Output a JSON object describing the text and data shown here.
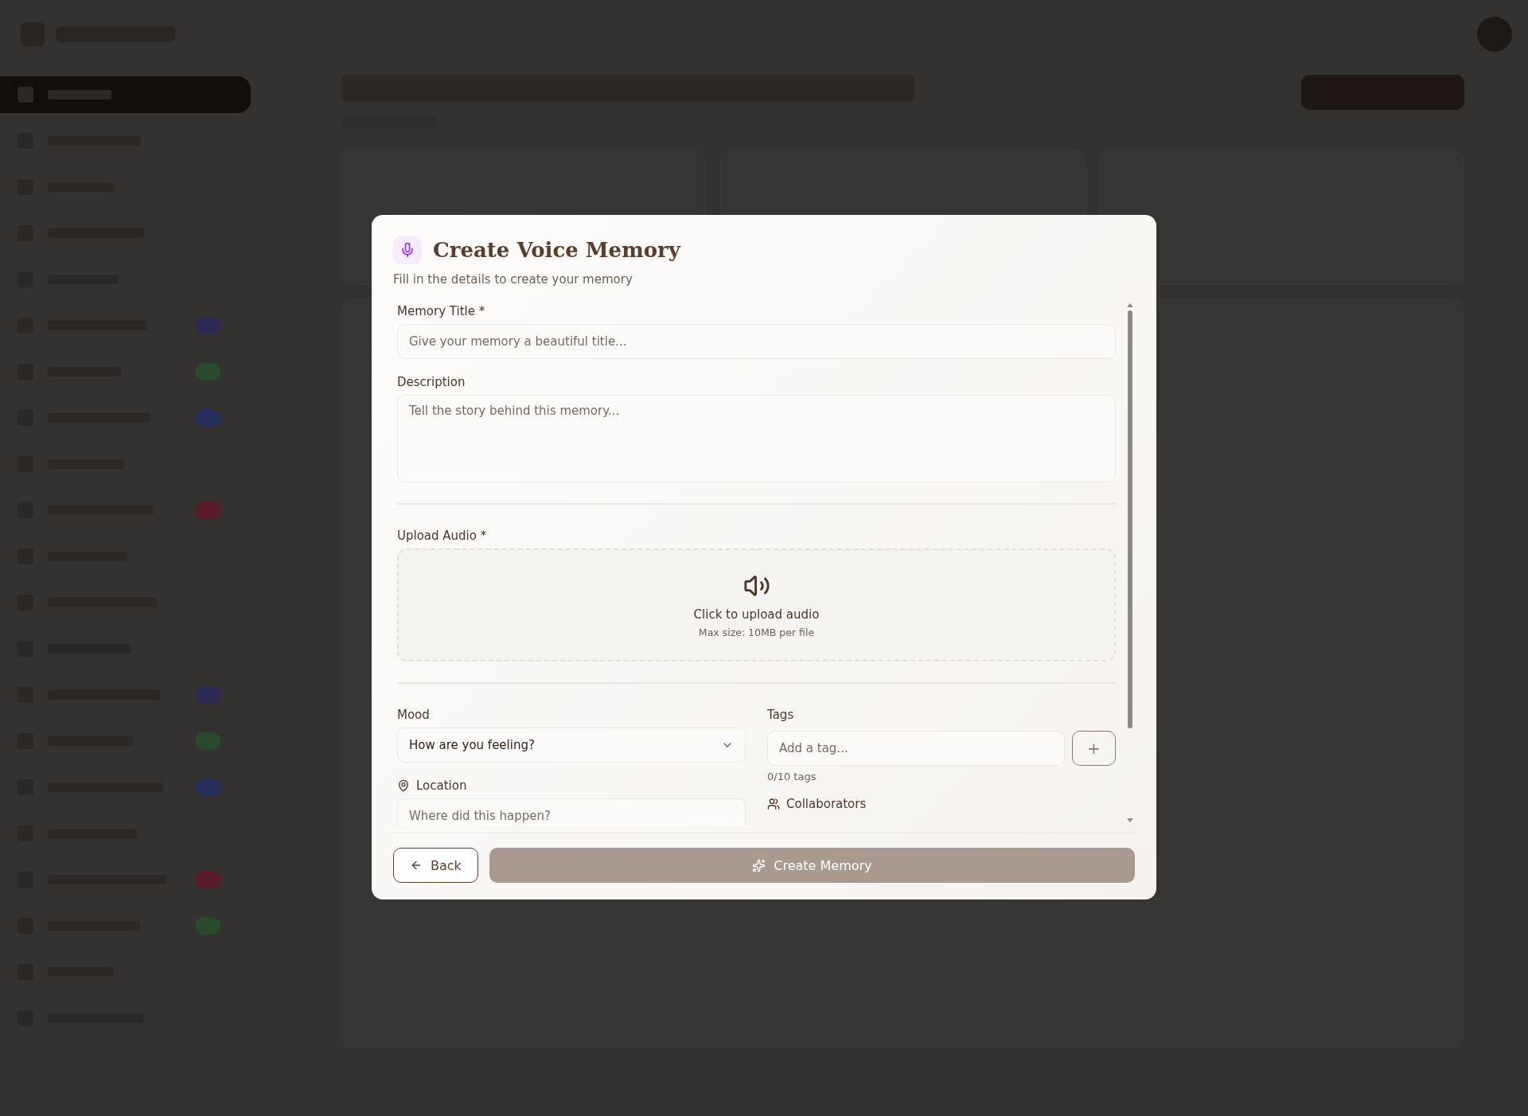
{
  "sidebar": {
    "items": [
      {
        "selected": true
      },
      {
        "selected": false
      },
      {
        "selected": false
      },
      {
        "selected": false
      },
      {
        "selected": false
      },
      {
        "selected": false
      },
      {
        "selected": false
      },
      {
        "selected": false
      },
      {
        "selected": false
      },
      {
        "selected": false
      },
      {
        "selected": false
      },
      {
        "selected": false
      },
      {
        "selected": false
      },
      {
        "selected": false
      },
      {
        "selected": false
      },
      {
        "selected": false
      },
      {
        "selected": false
      },
      {
        "selected": false
      },
      {
        "selected": false
      },
      {
        "selected": false
      },
      {
        "selected": false
      }
    ]
  },
  "dialog": {
    "title": "Create Voice Memory",
    "subtitle": "Fill in the details to create your memory",
    "title_field": {
      "label": "Memory Title *",
      "placeholder": "Give your memory a beautiful title..."
    },
    "description_field": {
      "label": "Description",
      "placeholder": "Tell the story behind this memory..."
    },
    "upload": {
      "label": "Upload Audio *",
      "prompt": "Click to upload audio",
      "hint": "Max size: 10MB per file"
    },
    "mood": {
      "label": "Mood",
      "value": "How are you feeling?"
    },
    "tags": {
      "label": "Tags",
      "placeholder": "Add a tag...",
      "add_button": "+",
      "count": "0/10 tags"
    },
    "location": {
      "label": "Location",
      "placeholder": "Where did this happen?"
    },
    "collaborators": {
      "label": "Collaborators"
    },
    "back_button": "Back",
    "create_button": "Create Memory"
  }
}
